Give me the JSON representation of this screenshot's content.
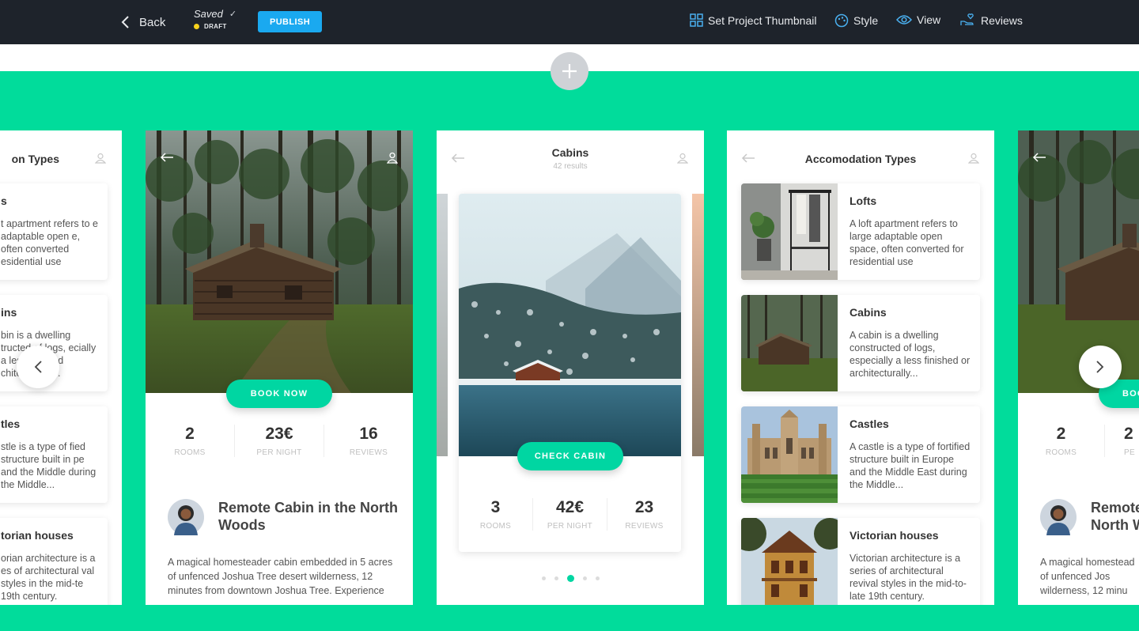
{
  "topbar": {
    "back_label": "Back",
    "saved_label": "Saved",
    "check_mark": "✓",
    "status_label": "DRAFT",
    "publish_label": "PUBLISH",
    "nav": [
      {
        "label": "Set Project Thumbnail",
        "icon": "grid-icon"
      },
      {
        "label": "Style",
        "icon": "palette-icon"
      },
      {
        "label": "View",
        "icon": "eye-icon"
      },
      {
        "label": "Reviews",
        "icon": "hand-heart-icon"
      }
    ]
  },
  "accommodation": {
    "title": "Accomodation Types",
    "title_cropped": "on Types",
    "items": [
      {
        "title": "Lofts",
        "desc": "A loft apartment refers to large adaptable open space, often converted for residential use",
        "title_cropped": "s",
        "desc_cropped": "t apartment refers to e adaptable open e, often converted esidential use"
      },
      {
        "title": "Cabins",
        "desc": "A cabin is a dwelling constructed of logs, especially a less finished or architecturally...",
        "title_cropped": "ins",
        "desc_cropped": "bin is a dwelling tructed of logs, ecially a less finished chitecturally..."
      },
      {
        "title": "Castles",
        "desc": "A castle is a type of fortified structure built in Europe and the Middle East during the Middle...",
        "title_cropped": "tles",
        "desc_cropped": "stle is a type of fied structure built in pe and the Middle during the Middle..."
      },
      {
        "title": "Victorian houses",
        "desc": "Victorian architecture is a series of architectural revival styles in the mid-to-late 19th century.",
        "title_cropped": "torian houses",
        "desc_cropped": "orian architecture is a es of architectural val styles in the mid-te 19th century."
      }
    ]
  },
  "cabin_detail": {
    "book_label": "BOOK NOW",
    "stats": [
      {
        "value": "2",
        "label": "ROOMS"
      },
      {
        "value": "23€",
        "label": "PER NIGHT"
      },
      {
        "value": "16",
        "label": "REVIEWS"
      }
    ],
    "title": "Remote Cabin in the North Woods",
    "title_cropped": "Remote North W",
    "description": "A magical homesteader cabin embedded in 5 acres of unfenced Joshua Tree desert wilderness, 12 minutes from downtown Joshua Tree. Experience",
    "description_cropped": "A magical homestead of unfenced Jos wilderness, 12 minu",
    "stats_cropped": [
      {
        "value": "2",
        "label": "ROOMS"
      },
      {
        "value": "2",
        "label": "PE"
      }
    ],
    "book_cropped": "BOO"
  },
  "cabins_list": {
    "title": "Cabins",
    "subtitle": "42 results",
    "check_label": "CHECK CABIN",
    "stats": [
      {
        "value": "3",
        "label": "ROOMS"
      },
      {
        "value": "42€",
        "label": "PER NIGHT"
      },
      {
        "value": "23",
        "label": "REVIEWS"
      }
    ],
    "page_count": 5,
    "active_page": 3
  },
  "colors": {
    "topbar": "#1e232b",
    "accent": "#01dc9b",
    "button": "#00d6a2",
    "publish": "#1aa9f0"
  }
}
